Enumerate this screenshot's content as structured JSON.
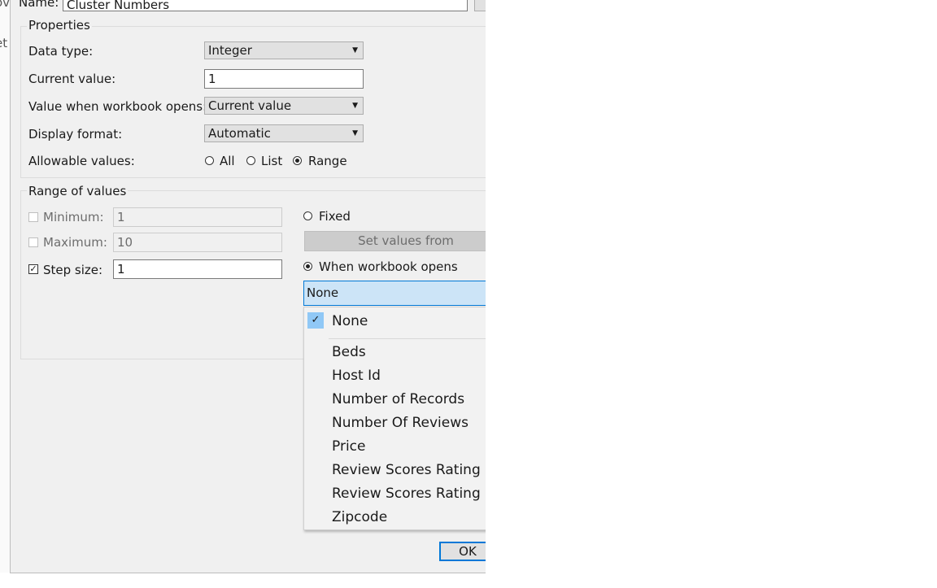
{
  "name_field": {
    "label": "Name:",
    "value": "Cluster Numbers"
  },
  "properties": {
    "title": "Properties",
    "data_type_label": "Data type:",
    "data_type_value": "Integer",
    "current_value_label": "Current value:",
    "current_value": "1",
    "workbook_opens_label": "Value when workbook opens:",
    "workbook_opens_value": "Current value",
    "display_format_label": "Display format:",
    "display_format_value": "Automatic",
    "allowable_label": "Allowable values:",
    "allowable_options": [
      "All",
      "List",
      "Range"
    ],
    "allowable_selected": "Range"
  },
  "range": {
    "title": "Range of values",
    "minimum_label": "Minimum:",
    "minimum_value": "1",
    "maximum_label": "Maximum:",
    "maximum_value": "10",
    "step_label": "Step size:",
    "step_value": "1",
    "fixed_label": "Fixed",
    "set_values_label": "Set values from",
    "when_opens_label": "When workbook opens",
    "source_selected": "None"
  },
  "dropdown": {
    "checked_item": "None",
    "items": [
      "Beds",
      "Host Id",
      "Number of Records",
      "Number Of Reviews",
      "Price",
      "Review Scores Rating",
      "Review Scores Rating (b",
      "Zipcode"
    ]
  },
  "ok_label": "OK",
  "colors": {
    "accent": "#0078d7",
    "selection": "#cce4f7",
    "dialog_bg": "#f0f0f0"
  }
}
